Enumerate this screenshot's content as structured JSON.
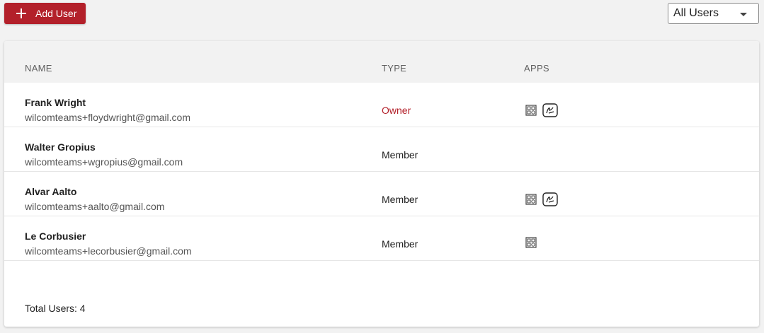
{
  "toolbar": {
    "add_user_label": "Add User",
    "filter_value": "All Users"
  },
  "table": {
    "headers": {
      "name": "NAME",
      "type": "TYPE",
      "apps": "APPS"
    },
    "rows": [
      {
        "name": "Frank Wright",
        "email": "wilcomteams+floydwright@gmail.com",
        "type": "Owner",
        "apps": [
          "grid-app-icon",
          "signature-app-icon"
        ]
      },
      {
        "name": "Walter Gropius",
        "email": "wilcomteams+wgropius@gmail.com",
        "type": "Member",
        "apps": []
      },
      {
        "name": "Alvar Aalto",
        "email": "wilcomteams+aalto@gmail.com",
        "type": "Member",
        "apps": [
          "grid-app-icon",
          "signature-app-icon"
        ]
      },
      {
        "name": "Le Corbusier",
        "email": "wilcomteams+lecorbusier@gmail.com",
        "type": "Member",
        "apps": [
          "grid-app-icon"
        ]
      }
    ]
  },
  "footer": {
    "total_label": "Total Users: 4"
  },
  "colors": {
    "accent": "#b3202a",
    "header_bg": "#f2f2f2"
  }
}
